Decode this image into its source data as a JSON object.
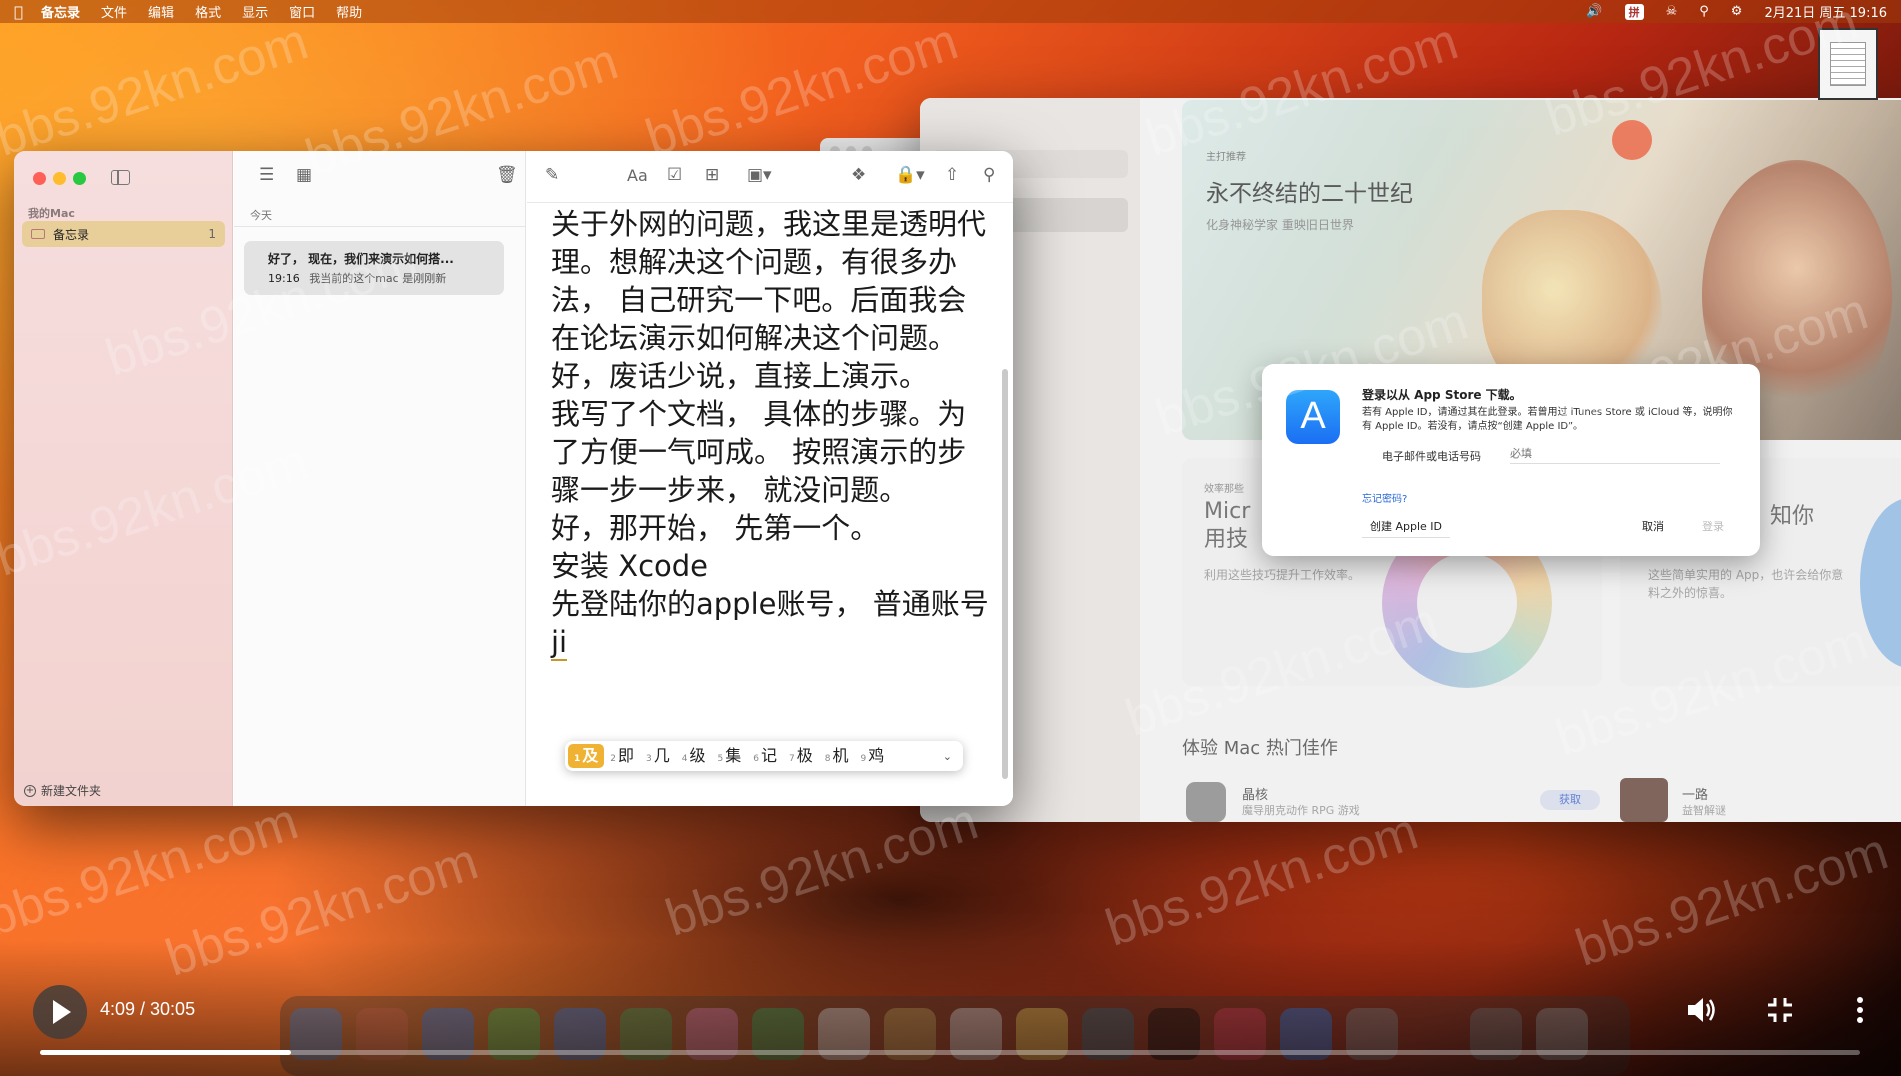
{
  "menubar": {
    "app_name": "备忘录",
    "items": [
      "文件",
      "编辑",
      "格式",
      "显示",
      "窗口",
      "帮助"
    ],
    "ime": "拼",
    "clock": "2月21日 周五 19:16"
  },
  "notes": {
    "sidebar": {
      "section": "我的Mac",
      "folder": "备忘录",
      "folder_count": "1",
      "new_folder": "新建文件夹"
    },
    "list": {
      "date_header": "今天",
      "note_title": "好了， 现在，我们来演示如何搭...",
      "note_time": "19:16",
      "note_preview": "我当前的这个mac 是刚刚新"
    },
    "editor": {
      "lines": [
        "关于外网的问题，我这里是透明代理。想解决这个问题，有很多办法， 自己研究一下吧。后面我会在论坛演示如何解决这个问题。好，废话少说，直接上演示。",
        "我写了个文档， 具体的步骤。为了方便一气呵成。 按照演示的步骤一步一步来， 就没问题。",
        "好，那开始， 先第一个。",
        "安装 Xcode",
        "先登陆你的apple账号， 普通账号"
      ],
      "composing": "ji"
    },
    "candidates": [
      {
        "n": "1",
        "c": "及"
      },
      {
        "n": "2",
        "c": "即"
      },
      {
        "n": "3",
        "c": "几"
      },
      {
        "n": "4",
        "c": "级"
      },
      {
        "n": "5",
        "c": "集"
      },
      {
        "n": "6",
        "c": "记"
      },
      {
        "n": "7",
        "c": "极"
      },
      {
        "n": "8",
        "c": "机"
      },
      {
        "n": "9",
        "c": "鸡"
      }
    ]
  },
  "appstore": {
    "hero": {
      "kicker": "主打推荐",
      "title": "永不终结的二十世纪",
      "subtitle": "化身神秘学家 重映旧日世界"
    },
    "card1": {
      "kicker": "效率那些",
      "title_line1": "Micr",
      "title_line2": "用技",
      "subtitle": "利用这些技巧提升工作效率。"
    },
    "card2": {
      "title": "知你",
      "subtitle": "这些简单实用的 App，也许会给你意料之外的惊喜。"
    },
    "section_title": "体验 Mac 热门佳作",
    "app1": {
      "name": "晶核",
      "subtitle": "魔导朋克动作 RPG 游戏",
      "get": "获取"
    },
    "app2": {
      "name": "一路",
      "subtitle": "益智解谜"
    }
  },
  "login_dialog": {
    "title": "登录以从 App Store 下载。",
    "description": "若有 Apple ID，请通过其在此登录。若曾用过 iTunes Store 或 iCloud 等，说明你有 Apple ID。若没有，请点按“创建 Apple ID”。",
    "email_label": "电子邮件或电话号码",
    "email_placeholder": "必填",
    "forgot": "忘记密码?",
    "create": "创建 Apple ID",
    "cancel": "取消",
    "login": "登录"
  },
  "video": {
    "time": "4:09 / 30:05",
    "progress": 0.138
  },
  "watermark": "bbs.92kn.com"
}
